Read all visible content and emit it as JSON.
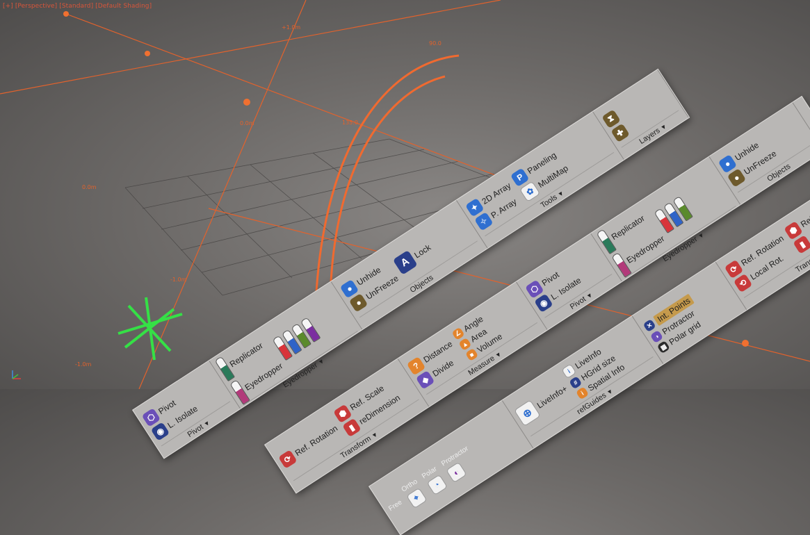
{
  "viewport": {
    "label": "[+] [Perspective] [Standard] [Default Shading]",
    "measure_labels": [
      "+1.0m",
      "0.0m",
      "90.0",
      "135.0",
      "0.0m",
      "-1.0m",
      "-1.0m"
    ]
  },
  "colors": {
    "accent": "#e8622c",
    "gizmo": "#35e046",
    "ribbon": "#b9b7b5"
  },
  "ribbon1": {
    "pivot": "Pivot",
    "lisolate": "L. Isolate",
    "pivot_title": "Pivot",
    "replicator": "Replicator",
    "eyedropper": "Eyedropper",
    "eyedropper_title": "Eyedropper",
    "unhide": "Unhide",
    "unfreeze": "UnFreeze",
    "objects_title": "Objects",
    "lock": "Lock",
    "array2d": "2D Array",
    "parray": "P. Array",
    "paneling": "Paneling",
    "multimap": "MultiMap",
    "tools_title": "Tools",
    "layers_title": "Layers"
  },
  "ribbon2": {
    "ref_rotation": "Ref. Rotation",
    "ref_scale": "Ref. Scale",
    "redimension": "reDimension",
    "transform_title": "Transform",
    "distance": "Distance",
    "divide": "Divide",
    "angle": "Angle",
    "area": "Area",
    "volume": "Volume",
    "measure_title": "Measure",
    "pivot": "Pivot",
    "lisolate": "L. Isolate",
    "pivot_title": "Pivot",
    "replicator": "Replicator",
    "eyedropper": "Eyedropper",
    "eyedropper_title": "Eyedropper",
    "unhide": "Unhide",
    "unfreeze": "UnFreeze",
    "objects_title": "Objects"
  },
  "ribbon3": {
    "free_title": "Free",
    "ortho_title": "Ortho",
    "polar_title": "Polar",
    "protractor_title": "Protractor",
    "liveinfo_plus": "LiveInfo+",
    "liveinfo": "LiveInfo",
    "hgrid_size": "HGrid size",
    "spatial_info": "Spatial Info",
    "refguides_title": "refGuides",
    "int_points": "Int. Points",
    "protractor": "Protractor",
    "polar_grid": "Polar grid",
    "ref_rotation": "Ref. Rotation",
    "local_rot": "Local Rot.",
    "ref_scale": "Ref. Scale",
    "redimension": "reDimension",
    "transform_title": "Transform"
  }
}
